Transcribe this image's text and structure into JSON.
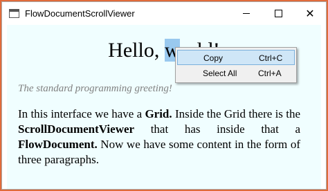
{
  "window": {
    "title": "FlowDocumentScrollViewer",
    "icon": "app-window-icon",
    "controls": {
      "minimize": "minimize-icon",
      "maximize": "maximize-icon",
      "close": "✕"
    }
  },
  "document": {
    "heading_before": "Hello, ",
    "heading_selected": "w",
    "heading_after": "orld!",
    "subtitle": "The standard programming greeting!",
    "paragraph": {
      "t1": "In this interface we have a ",
      "b1": "Grid.",
      "t2": " Inside the Grid there is the ",
      "b2": "ScrollDocumentViewer",
      "t3": " that has inside that a ",
      "b3": "FlowDocument.",
      "t4": " Now we have some content in the form of three paragraphs."
    }
  },
  "context_menu": {
    "items": [
      {
        "label": "Copy",
        "shortcut": "Ctrl+C",
        "highlighted": true
      },
      {
        "label": "Select All",
        "shortcut": "Ctrl+A",
        "highlighted": false
      }
    ]
  },
  "colors": {
    "document_background": "#f0feff",
    "selection": "#99c9ef",
    "menu_highlight": "#cfe6f7",
    "desktop_accent": "#e06a3a"
  }
}
